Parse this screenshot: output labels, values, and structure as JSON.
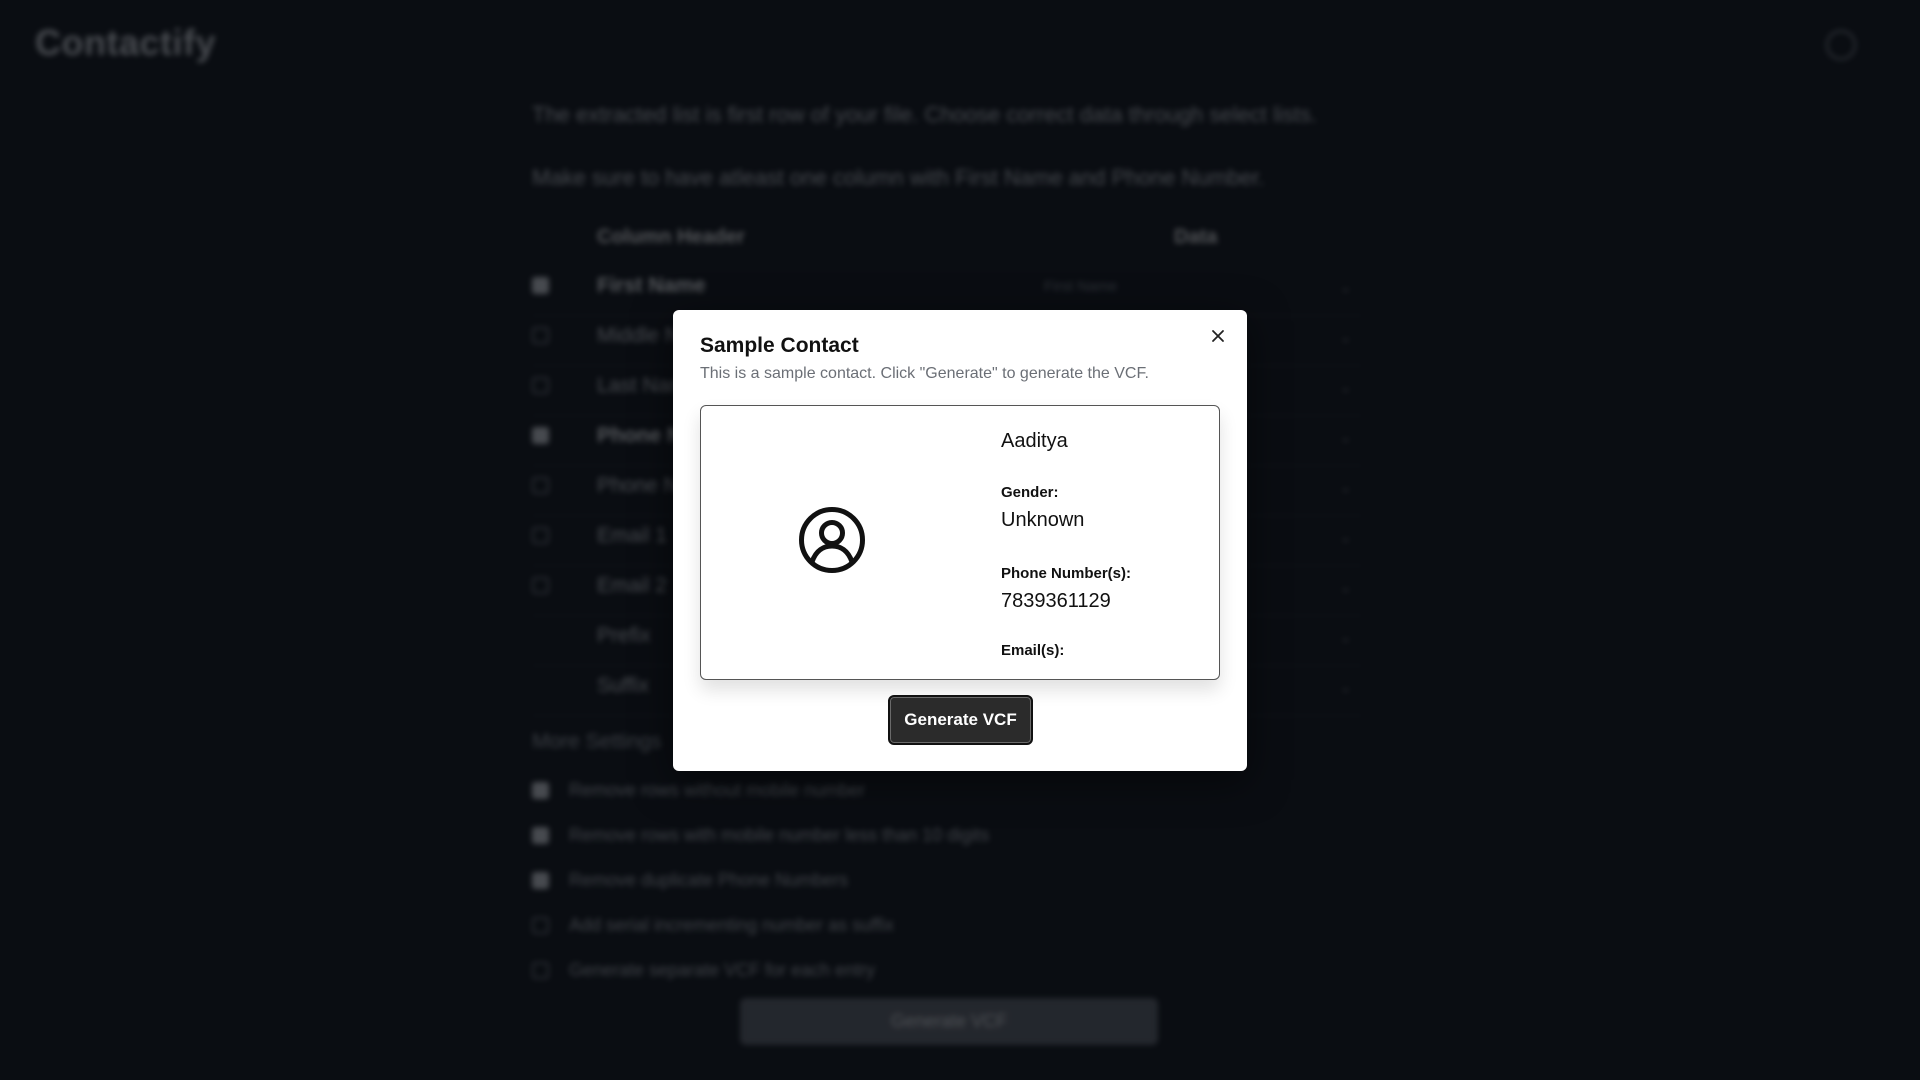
{
  "app": {
    "title": "Contactify"
  },
  "intro": {
    "line1": "The extracted list is first row of your file. Choose correct data through select lists.",
    "line2": "Make sure to have atleast one column with First Name and Phone Number."
  },
  "table": {
    "headers": [
      "Column Header",
      "Data"
    ],
    "rows": [
      {
        "label": "First Name",
        "checked": true,
        "bold": true,
        "select": "First Name"
      },
      {
        "label": "Middle Name",
        "checked": false,
        "bold": false,
        "select": ""
      },
      {
        "label": "Last Name",
        "checked": false,
        "bold": false,
        "select": ""
      },
      {
        "label": "Phone Number",
        "checked": true,
        "bold": true,
        "select": ""
      },
      {
        "label": "Phone Number 2",
        "checked": false,
        "bold": false,
        "select": ""
      },
      {
        "label": "Email 1",
        "checked": false,
        "bold": false,
        "select": ""
      },
      {
        "label": "Email 2",
        "checked": false,
        "bold": false,
        "select": ""
      },
      {
        "label": "Prefix",
        "checked": null,
        "bold": false,
        "select": ""
      },
      {
        "label": "Suffix",
        "checked": null,
        "bold": false,
        "select": ""
      }
    ]
  },
  "settings": {
    "title": "More Settings",
    "options": [
      {
        "label": "Remove rows without mobile number",
        "checked": true
      },
      {
        "label": "Remove rows with mobile number less than 10 digits",
        "checked": true
      },
      {
        "label": "Remove duplicate Phone Numbers",
        "checked": true
      },
      {
        "label": "Add serial incrementing number as suffix",
        "checked": false
      },
      {
        "label": "Generate separate VCF for each entry",
        "checked": false
      }
    ]
  },
  "background_button": {
    "label": "Generate VCF"
  },
  "modal": {
    "title": "Sample Contact",
    "description": "This is a sample contact. Click \"Generate\" to generate the VCF.",
    "contact": {
      "name": "Aaditya",
      "gender_label": "Gender:",
      "gender": "Unknown",
      "phone_label": "Phone Number(s):",
      "phone": "7839361129",
      "email_label": "Email(s):",
      "email": ""
    },
    "button_label": "Generate VCF",
    "close_icon": "close-icon",
    "avatar_icon": "user-circle-icon"
  }
}
